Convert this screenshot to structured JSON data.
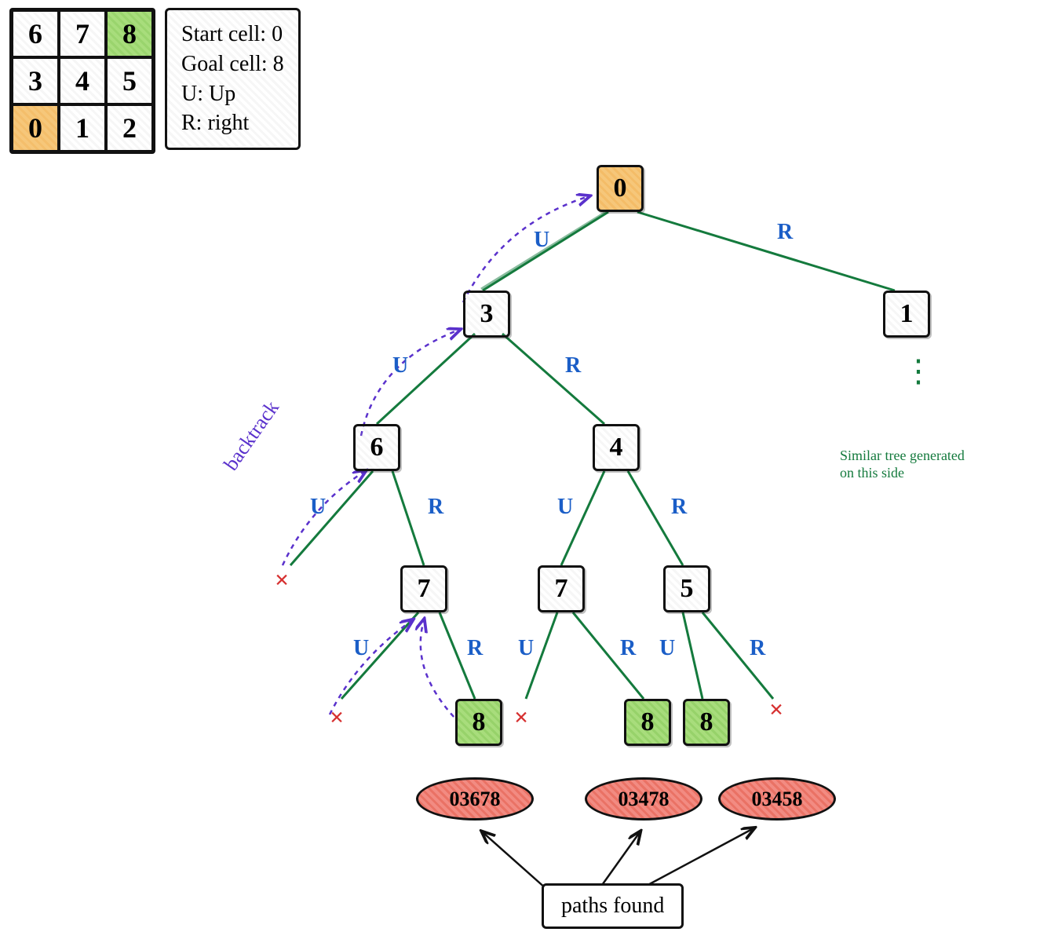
{
  "grid": {
    "rows": [
      [
        "6",
        "7",
        "8"
      ],
      [
        "3",
        "4",
        "5"
      ],
      [
        "0",
        "1",
        "2"
      ]
    ],
    "start_cell": "0",
    "goal_cell": "8"
  },
  "legend": {
    "l1": "Start cell: 0",
    "l2": "Goal cell: 8",
    "l3": "U: Up",
    "l4": "R: right"
  },
  "tree": {
    "nodes": {
      "root": "0",
      "n3": "3",
      "n1": "1",
      "n6": "6",
      "n4": "4",
      "n7a": "7",
      "n7b": "7",
      "n5": "5",
      "g1": "8",
      "g2": "8",
      "g3": "8"
    },
    "edge_labels": {
      "U": "U",
      "R": "R"
    },
    "x_mark": "×",
    "ellipsis": "⋮",
    "similar_note_l1": "Similar tree generated",
    "similar_note_l2": "on this side"
  },
  "backtrack_label": "backtrack",
  "paths": {
    "p1": "03678",
    "p2": "03478",
    "p3": "03458",
    "box_label": "paths found"
  }
}
